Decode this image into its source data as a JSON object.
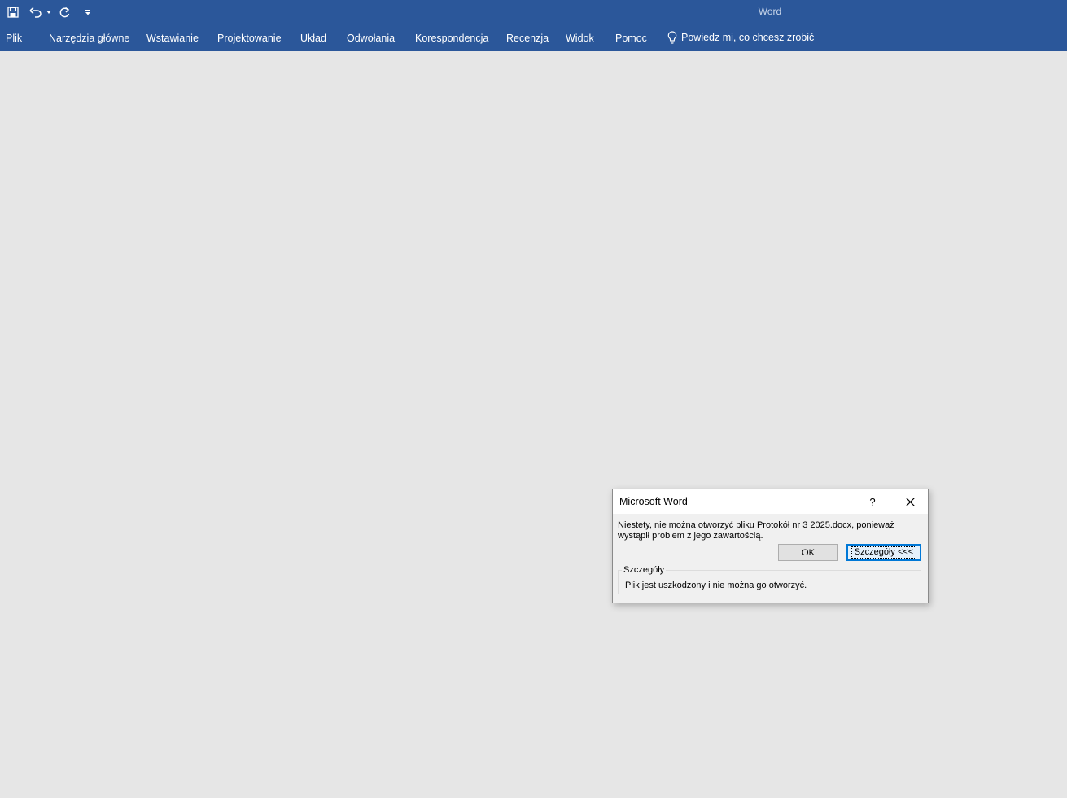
{
  "app": {
    "title": "Word"
  },
  "quick_access": {
    "save_icon": "save-icon",
    "undo_icon": "undo-icon",
    "undo_dropdown_icon": "chevron-down-icon",
    "redo_icon": "redo-icon",
    "customize_icon": "customize-toolbar-icon"
  },
  "ribbon": {
    "tabs": [
      {
        "label": "Plik"
      },
      {
        "label": "Narzędzia główne"
      },
      {
        "label": "Wstawianie"
      },
      {
        "label": "Projektowanie"
      },
      {
        "label": "Układ"
      },
      {
        "label": "Odwołania"
      },
      {
        "label": "Korespondencja"
      },
      {
        "label": "Recenzja"
      },
      {
        "label": "Widok"
      },
      {
        "label": "Pomoc"
      }
    ],
    "tell_me": "Powiedz mi, co chcesz zrobić",
    "tell_me_icon": "lightbulb-icon"
  },
  "dialog": {
    "title": "Microsoft Word",
    "help_label": "?",
    "message_line1": "Niestety, nie można otworzyć pliku Protokół nr 3 2025.docx, ponieważ",
    "message_line2": "wystąpił problem z jego zawartością.",
    "ok_label": "OK",
    "details_button_label": "Szczegóły <<<",
    "details_legend": "Szczegóły",
    "details_text": "Plik jest uszkodzony i nie można go otworzyć."
  },
  "colors": {
    "titlebar": "#2b579a",
    "workspace": "#e6e6e6",
    "dialog_bg": "#f0f0f0",
    "focus_accent": "#0078d7"
  }
}
